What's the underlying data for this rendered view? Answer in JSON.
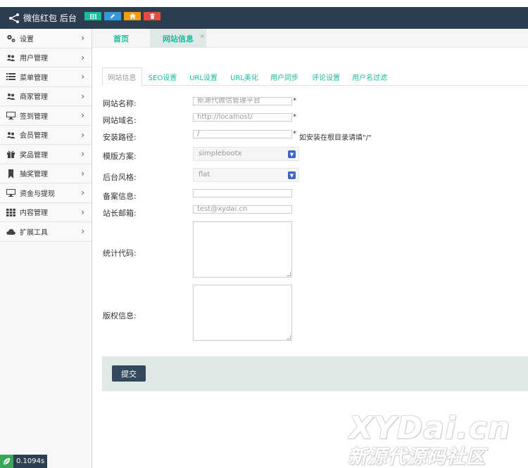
{
  "navbar": {
    "brand_icon": "share-nodes-icon",
    "brand_title": "微信红包 后台",
    "quick_buttons": [
      {
        "icon": "grid-icon",
        "color": "#1abc9c"
      },
      {
        "icon": "pencil-icon",
        "color": "#3498db"
      },
      {
        "icon": "home-icon",
        "color": "#f39c12"
      },
      {
        "icon": "trash-icon",
        "color": "#e74c3c"
      }
    ],
    "background": "#2c3e50"
  },
  "sidebar": {
    "items": [
      {
        "label": "设置",
        "icon": "gears-icon"
      },
      {
        "label": "用户管理",
        "icon": "users-icon"
      },
      {
        "label": "菜单管理",
        "icon": "list-icon"
      },
      {
        "label": "商家管理",
        "icon": "users-icon"
      },
      {
        "label": "签到管理",
        "icon": "monitor-icon"
      },
      {
        "label": "会员管理",
        "icon": "users-icon"
      },
      {
        "label": "奖品管理",
        "icon": "gift-icon"
      },
      {
        "label": "抽奖管理",
        "icon": "bookmark-icon"
      },
      {
        "label": "资金与提现",
        "icon": "monitor-icon"
      },
      {
        "label": "内容管理",
        "icon": "grid-icon"
      },
      {
        "label": "扩展工具",
        "icon": "cloud-icon"
      }
    ],
    "timer": "0.1094s"
  },
  "content_tabs": {
    "home": "首页",
    "active": "网站信息",
    "close": "×"
  },
  "inner_tabs": [
    "网站信息",
    "SEO设置",
    "URL设置",
    "URL美化",
    "用户同步",
    "评论设置",
    "用户名过滤"
  ],
  "form": {
    "site_name_label": "网站名称:",
    "site_name_value": "新源代微信管理平台",
    "site_domain_label": "网站域名:",
    "site_domain_value": "http://localhost/",
    "install_path_label": "安装路径:",
    "install_path_value": "/",
    "install_path_hint": "如安装在根目录请填\"/\"",
    "required_mark": "*",
    "template_label": "模版方案:",
    "template_value": "simplebootx",
    "admin_style_label": "后台风格:",
    "admin_style_value": "flat",
    "icp_label": "备案信息:",
    "icp_value": "",
    "email_label": "站长邮箱:",
    "email_value": "test@xydai.cn",
    "stats_label": "统计代码:",
    "copyright_label": "版权信息:",
    "submit_label": "提交"
  },
  "watermark": {
    "line1": "XYDai.cn",
    "line2": "新源代源码社区"
  }
}
